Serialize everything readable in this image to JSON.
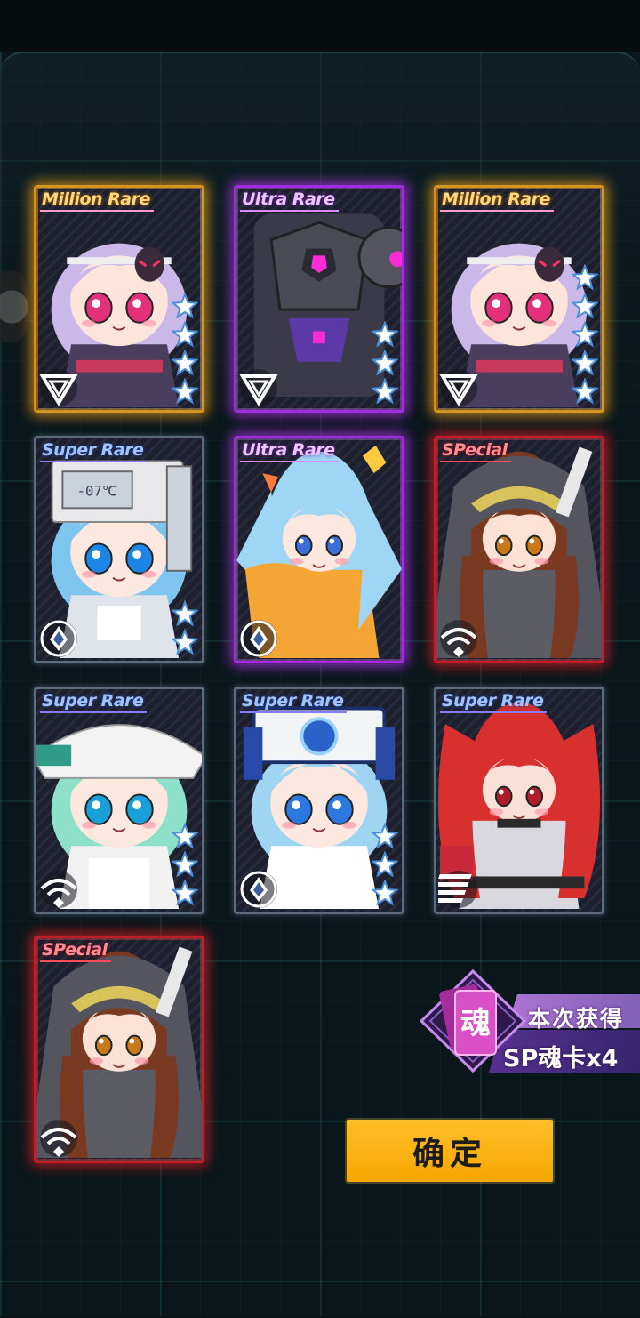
{
  "cards": [
    {
      "rarity": "Million Rare",
      "tier": "gold",
      "type_icon": "triangle-emblem-icon",
      "stars": 4,
      "portrait": "purple-haired-girl-with-demon-mask"
    },
    {
      "rarity": "Ultra Rare",
      "tier": "purple",
      "type_icon": "triangle-emblem-icon",
      "stars": 3,
      "portrait": "armored-robot-mech"
    },
    {
      "rarity": "Million Rare",
      "tier": "gold",
      "type_icon": "triangle-emblem-icon",
      "stars": 5,
      "portrait": "purple-haired-girl-with-demon-mask"
    },
    {
      "rarity": "Super Rare",
      "tier": "blue",
      "type_icon": "diamond-emblem-icon",
      "stars": 2,
      "portrait": "blue-haired-girl-with-thermometer-hat",
      "hat_text": "-07℃"
    },
    {
      "rarity": "Ultra Rare",
      "tier": "purple",
      "type_icon": "diamond-emblem-icon",
      "stars": 0,
      "portrait": "blue-twintail-idol-girl"
    },
    {
      "rarity": "SPecial",
      "tier": "red",
      "type_icon": "wifi-emblem-icon",
      "stars": 0,
      "portrait": "brown-haired-hooded-girl"
    },
    {
      "rarity": "Super Rare",
      "tier": "blue",
      "type_icon": "wifi-emblem-icon",
      "stars": 3,
      "portrait": "green-haired-girl-with-white-hat"
    },
    {
      "rarity": "Super Rare",
      "tier": "blue",
      "type_icon": "diamond-emblem-icon",
      "stars": 3,
      "portrait": "blue-haired-girl-with-robot-helmet"
    },
    {
      "rarity": "Super Rare",
      "tier": "blue",
      "type_icon": "slash-emblem-icon",
      "stars": 0,
      "portrait": "red-twintail-girl-with-chain"
    },
    {
      "rarity": "SPecial",
      "tier": "red",
      "type_icon": "wifi-emblem-icon",
      "stars": 0,
      "portrait": "brown-haired-hooded-girl"
    }
  ],
  "reward": {
    "emblem_char": "魂",
    "title": "本次获得",
    "value": "SP魂卡x4"
  },
  "confirm_label": "确定",
  "colors": {
    "gold": "#d6951e",
    "purple": "#a12ce0",
    "blue": "#5d6b7d",
    "red": "#c41c28",
    "button": "#ffb300"
  }
}
